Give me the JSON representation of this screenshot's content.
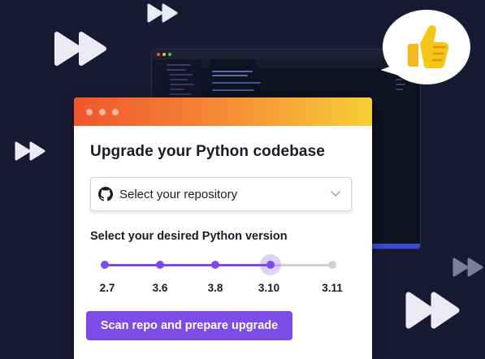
{
  "colors": {
    "background": "#181a33",
    "accent": "#7c4de6",
    "header_gradient": [
      "#f0552e",
      "#f58a35",
      "#f7cf37"
    ],
    "decor_arrow": "#ecebf5",
    "thumbs": "#f5c518"
  },
  "decorations": {
    "fast_forward_icons": [
      "fast-forward-icon",
      "fast-forward-icon",
      "fast-forward-icon",
      "fast-forward-icon",
      "fast-forward-icon"
    ],
    "thumbs_up_icon": "thumbs-up-icon",
    "background_window": "code-editor-screenshot"
  },
  "dialog": {
    "title": "Upgrade your Python codebase",
    "repo_select": {
      "icon": "github-icon",
      "selected": "Select your repository"
    },
    "version_label": "Select your desired Python version",
    "versions": [
      "2.7",
      "3.6",
      "3.8",
      "3.10",
      "3.11"
    ],
    "selected_version": "3.10",
    "selected_index": 3,
    "scan_button": "Scan repo and prepare upgrade"
  }
}
